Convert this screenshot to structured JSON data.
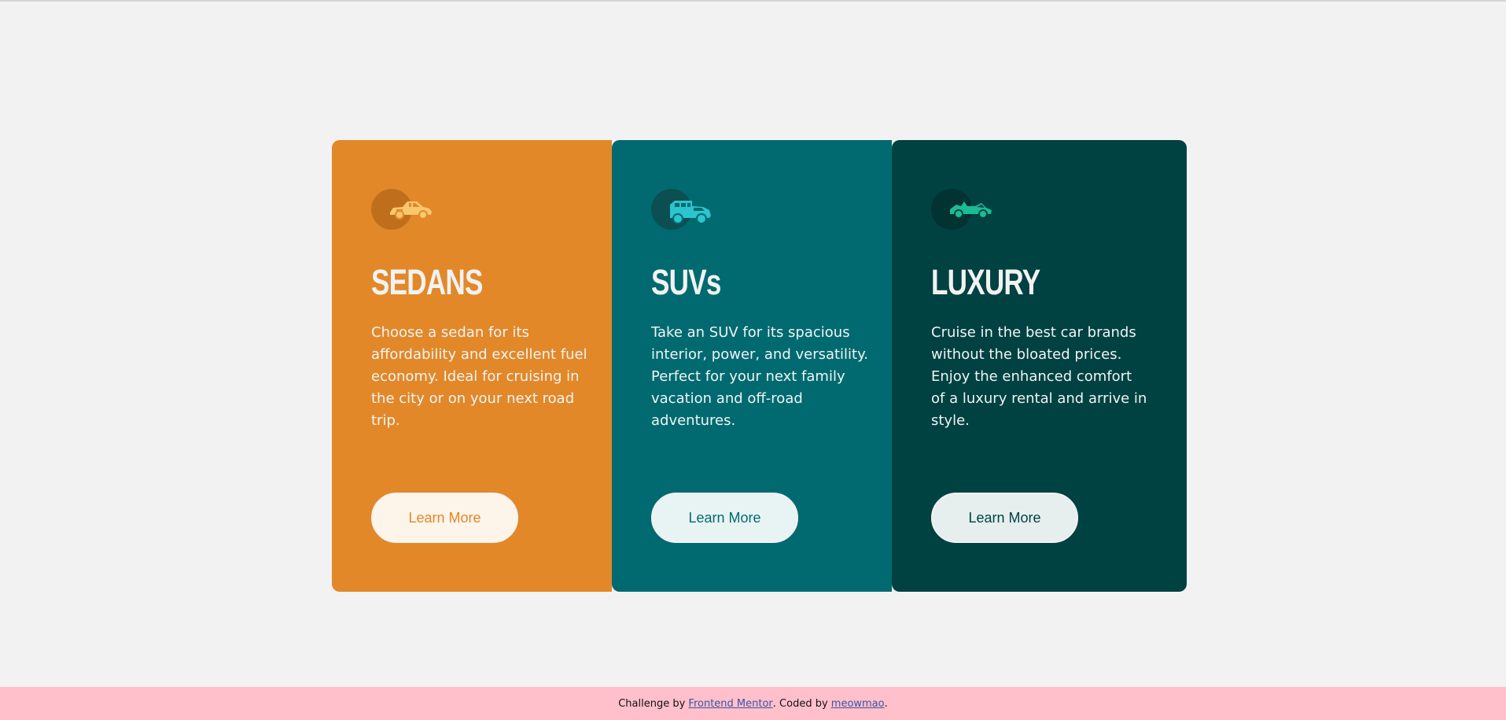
{
  "cards": [
    {
      "icon": "sedan-car-icon",
      "title": "SEDANS",
      "text": "Choose a sedan for its affordability and excellent fuel economy. Ideal for cruising in the city or on your next road trip.",
      "button": "Learn More",
      "background": "#e28829",
      "icon_color": "#f9c86c"
    },
    {
      "icon": "suv-car-icon",
      "title": "SUVs",
      "text": "Take an SUV for its spacious interior, power, and versatility. Perfect for your next family vacation and off-road adventures.",
      "button": "Learn More",
      "background": "#006a70",
      "icon_color": "#2cc5cd"
    },
    {
      "icon": "luxury-car-icon",
      "title": "LUXURY",
      "text": "Cruise in the best car brands without the bloated prices. Enjoy the enhanced comfort of a luxury rental and arrive in style.",
      "button": "Learn More",
      "background": "#004142",
      "icon_color": "#1abc94"
    }
  ],
  "footer": {
    "prefix": "Challenge by ",
    "challenge_link": "Frontend Mentor",
    "middle": ". Coded by ",
    "author_link": "meowmao",
    "suffix": "."
  }
}
